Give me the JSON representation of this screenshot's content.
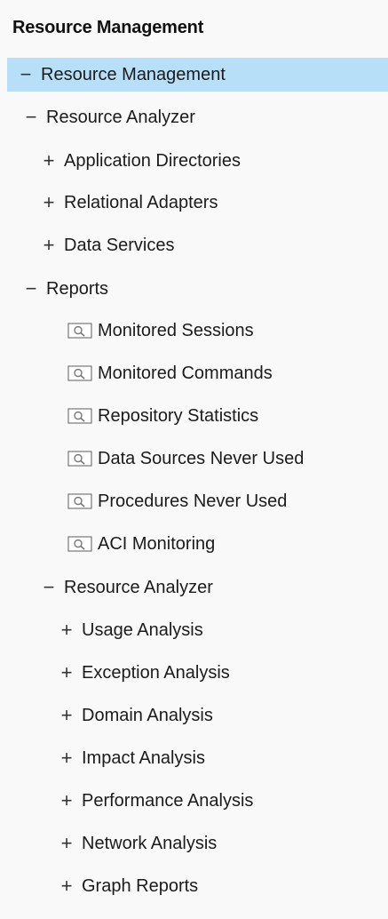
{
  "panel": {
    "title": "Resource Management"
  },
  "tree": {
    "root": {
      "label": "Resource Management",
      "toggle": "−"
    },
    "resource_analyzer_1": {
      "label": "Resource Analyzer",
      "toggle": "−",
      "children": [
        {
          "label": "Application Directories",
          "toggle": "+"
        },
        {
          "label": "Relational Adapters",
          "toggle": "+"
        },
        {
          "label": "Data Services",
          "toggle": "+"
        }
      ]
    },
    "reports": {
      "label": "Reports",
      "toggle": "−",
      "items": [
        {
          "label": "Monitored Sessions",
          "icon": "report-icon"
        },
        {
          "label": "Monitored Commands",
          "icon": "report-icon"
        },
        {
          "label": "Repository Statistics",
          "icon": "report-icon"
        },
        {
          "label": "Data Sources Never Used",
          "icon": "report-icon"
        },
        {
          "label": "Procedures Never Used",
          "icon": "report-icon"
        },
        {
          "label": "ACI Monitoring",
          "icon": "report-icon"
        }
      ]
    },
    "resource_analyzer_2": {
      "label": "Resource Analyzer",
      "toggle": "−",
      "children": [
        {
          "label": "Usage Analysis",
          "toggle": "+"
        },
        {
          "label": "Exception Analysis",
          "toggle": "+"
        },
        {
          "label": "Domain Analysis",
          "toggle": "+"
        },
        {
          "label": "Impact Analysis",
          "toggle": "+"
        },
        {
          "label": "Performance Analysis",
          "toggle": "+"
        },
        {
          "label": "Network Analysis",
          "toggle": "+"
        },
        {
          "label": "Graph Reports",
          "toggle": "+"
        }
      ]
    }
  },
  "colors": {
    "selected_bg": "#b7dff8",
    "panel_bg": "#f9f9f9"
  }
}
